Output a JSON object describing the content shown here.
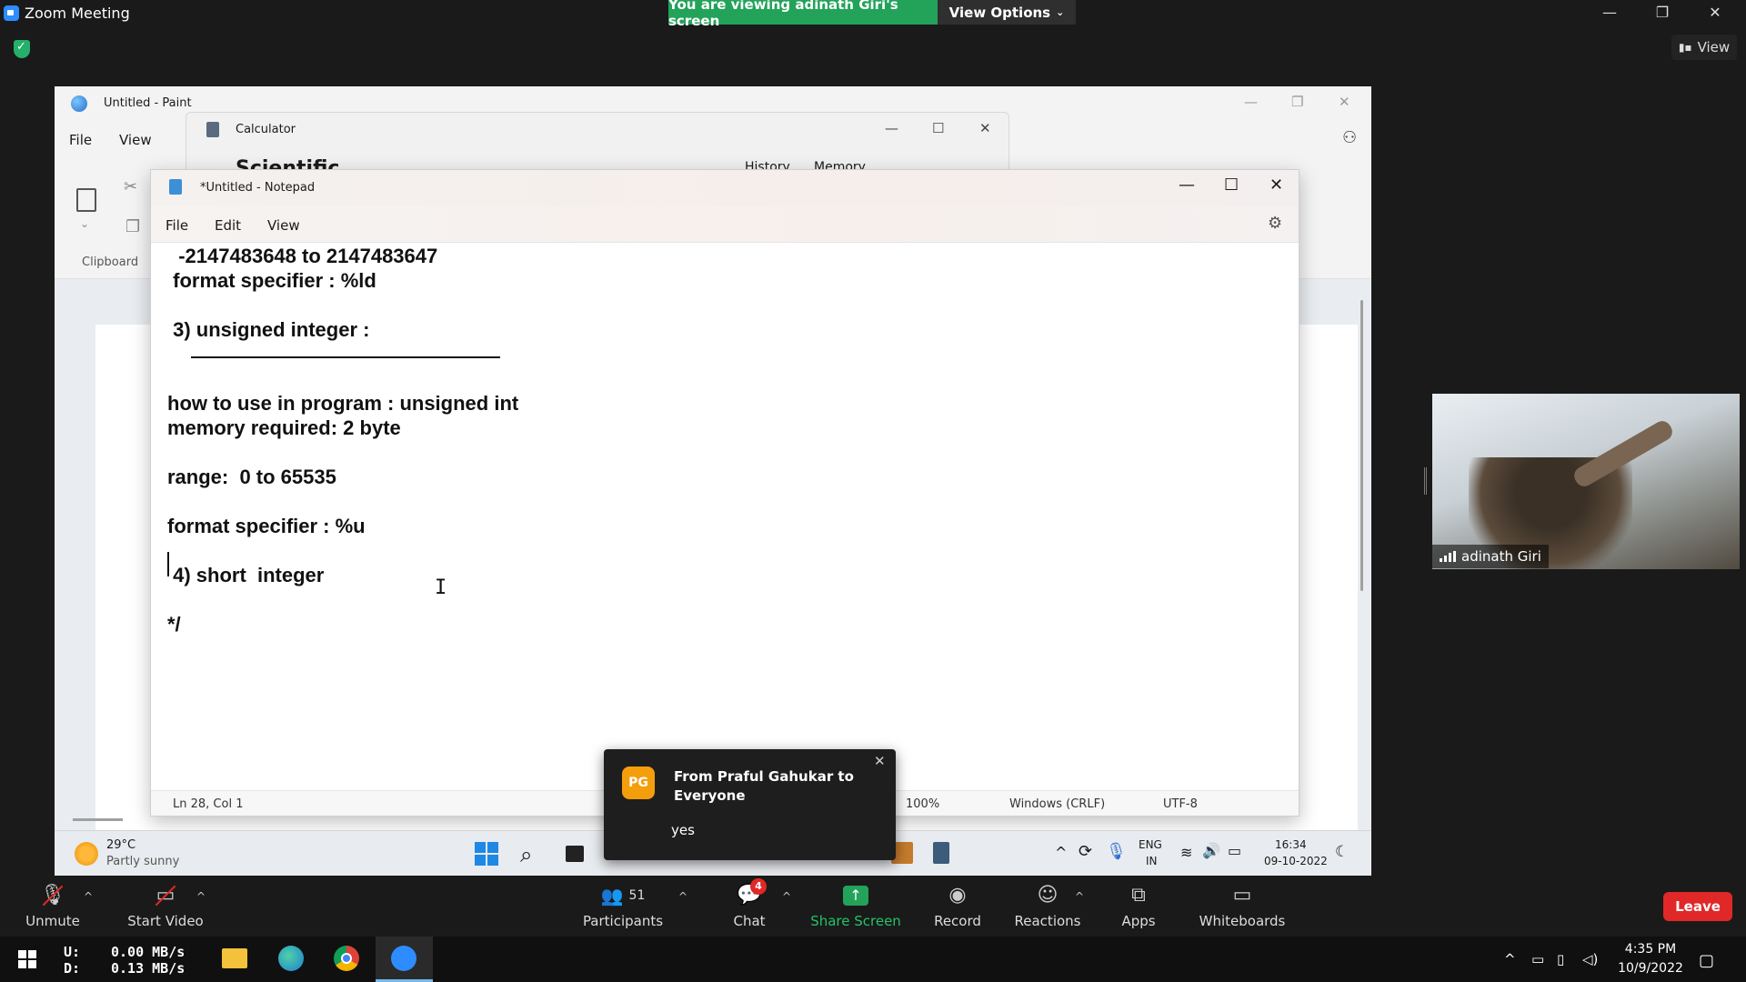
{
  "zoom": {
    "window_title": "Zoom Meeting",
    "viewing_banner": "You are viewing adinath Giri's screen",
    "view_options": "View Options",
    "view_button": "View",
    "window_controls": {
      "minimize": "—",
      "restore": "❐",
      "close": "✕"
    }
  },
  "paint": {
    "title": "Untitled - Paint",
    "menu": [
      "File",
      "View"
    ],
    "clipboard_label": "Clipboard"
  },
  "calculator": {
    "title": "Calculator",
    "mode": "Scientific",
    "tabs": [
      "History",
      "Memory"
    ]
  },
  "notepad": {
    "title": "*Untitled - Notepad",
    "menu": [
      "File",
      "Edit",
      "View"
    ],
    "lines": [
      "  -2147483648 to 2147483647",
      " format specifier : %ld",
      " 3) unsigned integer :",
      "how to use in program : unsigned int",
      "memory required: 2 byte",
      "range:  0 to 65535",
      "format specifier : %u",
      " 4) short  integer",
      "*/"
    ],
    "status": {
      "position": "Ln 28, Col 1",
      "zoom": "100%",
      "line_ending": "Windows (CRLF)",
      "encoding": "UTF-8"
    }
  },
  "inner_taskbar": {
    "weather_temp": "29°C",
    "weather_desc": "Partly sunny",
    "lang_top": "ENG",
    "lang_bottom": "IN",
    "time": "16:34",
    "date": "09-10-2022"
  },
  "chat_popup": {
    "avatar_initials": "PG",
    "from": "From Praful Gahukar to Everyone",
    "message": "yes"
  },
  "video": {
    "participant_name": "adinath Giri"
  },
  "toolbar": {
    "unmute": "Unmute",
    "start_video": "Start Video",
    "participants": "Participants",
    "participants_count": "51",
    "chat": "Chat",
    "chat_badge": "4",
    "share_screen": "Share Screen",
    "record": "Record",
    "reactions": "Reactions",
    "apps": "Apps",
    "whiteboards": "Whiteboards",
    "leave": "Leave"
  },
  "outer_taskbar": {
    "upload_label": "U:",
    "download_label": "D:",
    "upload_speed": "0.00 MB/s",
    "download_speed": "0.13 MB/s",
    "time": "4:35 PM",
    "date": "10/9/2022"
  },
  "colors": {
    "banner_green": "#23a25a",
    "leave_red": "#e02828",
    "chat_avatar": "#f59e0b"
  }
}
